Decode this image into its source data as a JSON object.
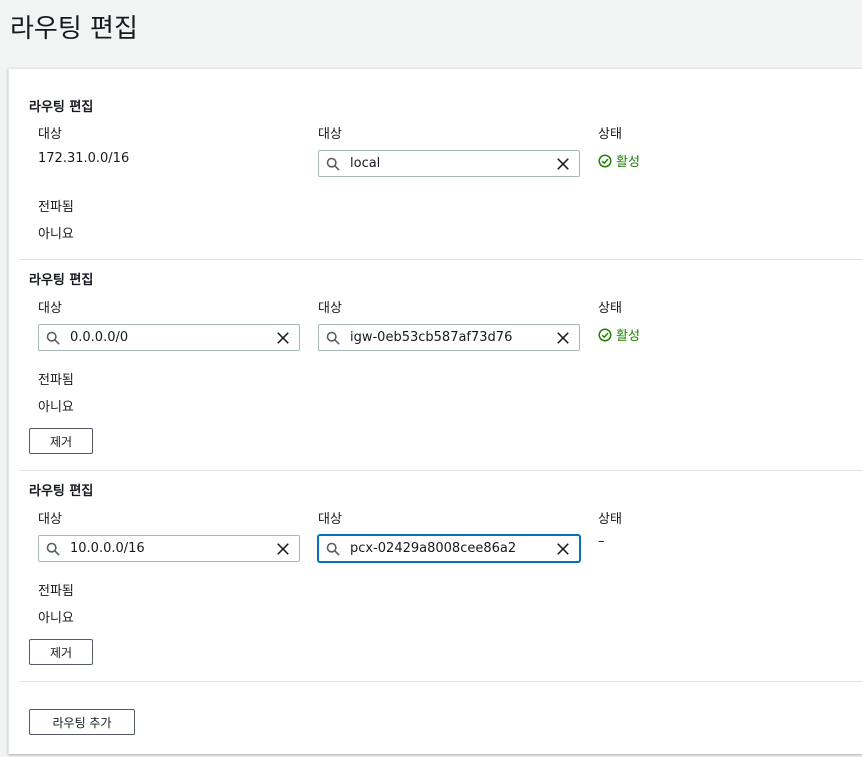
{
  "page": {
    "title": "라우팅 편집"
  },
  "routes": [
    {
      "section_title": "라우팅 편집",
      "destination_label": "대상",
      "destination_value": "172.31.0.0/16",
      "target_label": "대상",
      "target_value": "local",
      "status_label": "상태",
      "status_value": "활성",
      "propagated_label": "전파됨",
      "propagated_value": "아니요"
    },
    {
      "section_title": "라우팅 편집",
      "destination_label": "대상",
      "destination_value": "0.0.0.0/0",
      "target_label": "대상",
      "target_value": "igw-0eb53cb587af73d76",
      "status_label": "상태",
      "status_value": "활성",
      "propagated_label": "전파됨",
      "propagated_value": "아니요",
      "remove_label": "제거"
    },
    {
      "section_title": "라우팅 편집",
      "destination_label": "대상",
      "destination_value": "10.0.0.0/16",
      "target_label": "대상",
      "target_value": "pcx-02429a8008cee86a2",
      "status_label": "상태",
      "status_value": "–",
      "propagated_label": "전파됨",
      "propagated_value": "아니요",
      "remove_label": "제거"
    }
  ],
  "add_route_label": "라우팅 추가",
  "icons": {
    "search": "search-icon",
    "clear": "close-icon",
    "status_ok": "check-circle-icon"
  },
  "colors": {
    "status_active": "#1d8102",
    "focus": "#0073bb"
  }
}
